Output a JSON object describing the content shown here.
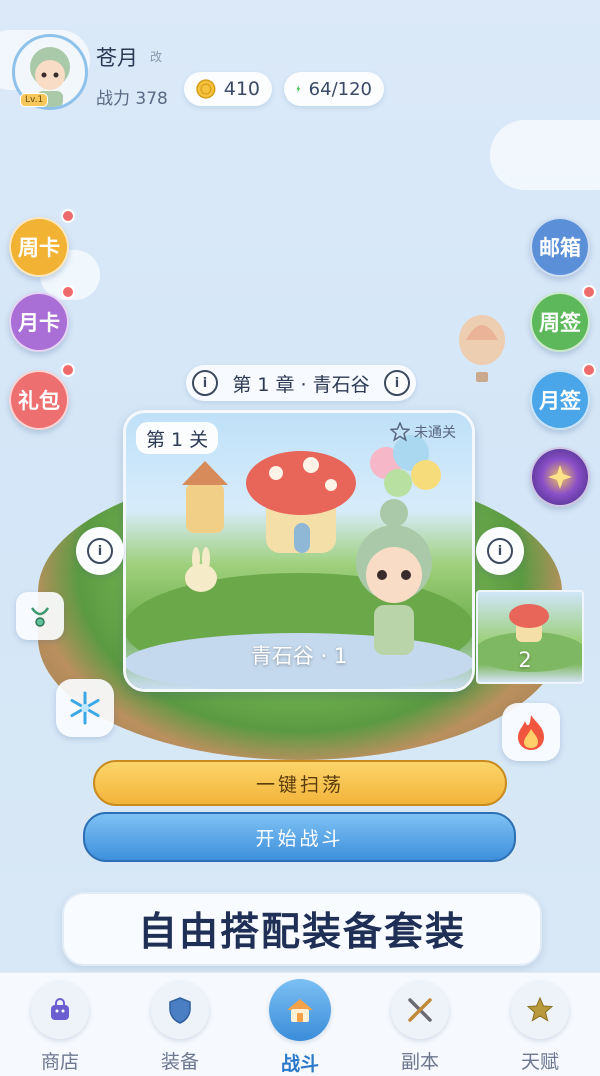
{
  "player": {
    "name": "苍月",
    "rename_label": "改",
    "level_badge": "Lv.1",
    "power_label": "战力 378"
  },
  "resources": {
    "coins": "410",
    "energy": "64/120"
  },
  "left_buttons": [
    {
      "label": "周卡",
      "color": "#f2b234",
      "badge": true
    },
    {
      "label": "月卡",
      "color": "#a96fd6",
      "badge": true
    },
    {
      "label": "礼包",
      "color": "#ee6f6f",
      "badge": true
    }
  ],
  "right_buttons": [
    {
      "label": "邮箱",
      "color": "#5b8fd8",
      "badge": false
    },
    {
      "label": "周签",
      "color": "#5cb85a",
      "badge": true
    },
    {
      "label": "月签",
      "color": "#4aa6e8",
      "badge": true
    }
  ],
  "chapter": {
    "title": "第 1 章 · 青石谷"
  },
  "stage": {
    "tag": "第 1 关",
    "status": "未通关",
    "name": "青石谷 · 1",
    "next_number": "2"
  },
  "actions": {
    "sweep_label": "一键扫荡",
    "fight_label": "开始战斗"
  },
  "banner": {
    "text": "自由搭配装备套装"
  },
  "nav": [
    {
      "label": "商店",
      "icon": "shop-bag-icon",
      "active": false
    },
    {
      "label": "装备",
      "icon": "shield-icon",
      "active": false
    },
    {
      "label": "战斗",
      "icon": "home-icon",
      "active": true
    },
    {
      "label": "副本",
      "icon": "crossed-swords-icon",
      "active": false
    },
    {
      "label": "天赋",
      "icon": "star-icon",
      "active": false
    }
  ]
}
